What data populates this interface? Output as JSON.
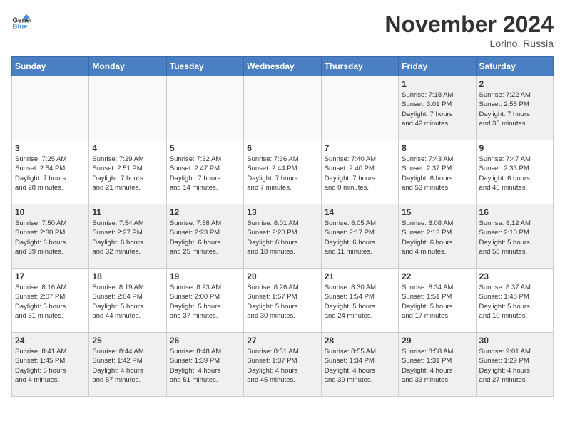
{
  "header": {
    "logo_general": "General",
    "logo_blue": "Blue",
    "month": "November 2024",
    "location": "Lorino, Russia"
  },
  "weekdays": [
    "Sunday",
    "Monday",
    "Tuesday",
    "Wednesday",
    "Thursday",
    "Friday",
    "Saturday"
  ],
  "weeks": [
    [
      {
        "day": "",
        "info": "",
        "empty": true
      },
      {
        "day": "",
        "info": "",
        "empty": true
      },
      {
        "day": "",
        "info": "",
        "empty": true
      },
      {
        "day": "",
        "info": "",
        "empty": true
      },
      {
        "day": "",
        "info": "",
        "empty": true
      },
      {
        "day": "1",
        "info": "Sunrise: 7:18 AM\nSunset: 3:01 PM\nDaylight: 7 hours\nand 42 minutes."
      },
      {
        "day": "2",
        "info": "Sunrise: 7:22 AM\nSunset: 2:58 PM\nDaylight: 7 hours\nand 35 minutes."
      }
    ],
    [
      {
        "day": "3",
        "info": "Sunrise: 7:25 AM\nSunset: 2:54 PM\nDaylight: 7 hours\nand 28 minutes."
      },
      {
        "day": "4",
        "info": "Sunrise: 7:29 AM\nSunset: 2:51 PM\nDaylight: 7 hours\nand 21 minutes."
      },
      {
        "day": "5",
        "info": "Sunrise: 7:32 AM\nSunset: 2:47 PM\nDaylight: 7 hours\nand 14 minutes."
      },
      {
        "day": "6",
        "info": "Sunrise: 7:36 AM\nSunset: 2:44 PM\nDaylight: 7 hours\nand 7 minutes."
      },
      {
        "day": "7",
        "info": "Sunrise: 7:40 AM\nSunset: 2:40 PM\nDaylight: 7 hours\nand 0 minutes."
      },
      {
        "day": "8",
        "info": "Sunrise: 7:43 AM\nSunset: 2:37 PM\nDaylight: 6 hours\nand 53 minutes."
      },
      {
        "day": "9",
        "info": "Sunrise: 7:47 AM\nSunset: 2:33 PM\nDaylight: 6 hours\nand 46 minutes."
      }
    ],
    [
      {
        "day": "10",
        "info": "Sunrise: 7:50 AM\nSunset: 2:30 PM\nDaylight: 6 hours\nand 39 minutes."
      },
      {
        "day": "11",
        "info": "Sunrise: 7:54 AM\nSunset: 2:27 PM\nDaylight: 6 hours\nand 32 minutes."
      },
      {
        "day": "12",
        "info": "Sunrise: 7:58 AM\nSunset: 2:23 PM\nDaylight: 6 hours\nand 25 minutes."
      },
      {
        "day": "13",
        "info": "Sunrise: 8:01 AM\nSunset: 2:20 PM\nDaylight: 6 hours\nand 18 minutes."
      },
      {
        "day": "14",
        "info": "Sunrise: 8:05 AM\nSunset: 2:17 PM\nDaylight: 6 hours\nand 11 minutes."
      },
      {
        "day": "15",
        "info": "Sunrise: 8:08 AM\nSunset: 2:13 PM\nDaylight: 6 hours\nand 4 minutes."
      },
      {
        "day": "16",
        "info": "Sunrise: 8:12 AM\nSunset: 2:10 PM\nDaylight: 5 hours\nand 58 minutes."
      }
    ],
    [
      {
        "day": "17",
        "info": "Sunrise: 8:16 AM\nSunset: 2:07 PM\nDaylight: 5 hours\nand 51 minutes."
      },
      {
        "day": "18",
        "info": "Sunrise: 8:19 AM\nSunset: 2:04 PM\nDaylight: 5 hours\nand 44 minutes."
      },
      {
        "day": "19",
        "info": "Sunrise: 8:23 AM\nSunset: 2:00 PM\nDaylight: 5 hours\nand 37 minutes."
      },
      {
        "day": "20",
        "info": "Sunrise: 8:26 AM\nSunset: 1:57 PM\nDaylight: 5 hours\nand 30 minutes."
      },
      {
        "day": "21",
        "info": "Sunrise: 8:30 AM\nSunset: 1:54 PM\nDaylight: 5 hours\nand 24 minutes."
      },
      {
        "day": "22",
        "info": "Sunrise: 8:34 AM\nSunset: 1:51 PM\nDaylight: 5 hours\nand 17 minutes."
      },
      {
        "day": "23",
        "info": "Sunrise: 8:37 AM\nSunset: 1:48 PM\nDaylight: 5 hours\nand 10 minutes."
      }
    ],
    [
      {
        "day": "24",
        "info": "Sunrise: 8:41 AM\nSunset: 1:45 PM\nDaylight: 5 hours\nand 4 minutes."
      },
      {
        "day": "25",
        "info": "Sunrise: 8:44 AM\nSunset: 1:42 PM\nDaylight: 4 hours\nand 57 minutes."
      },
      {
        "day": "26",
        "info": "Sunrise: 8:48 AM\nSunset: 1:39 PM\nDaylight: 4 hours\nand 51 minutes."
      },
      {
        "day": "27",
        "info": "Sunrise: 8:51 AM\nSunset: 1:37 PM\nDaylight: 4 hours\nand 45 minutes."
      },
      {
        "day": "28",
        "info": "Sunrise: 8:55 AM\nSunset: 1:34 PM\nDaylight: 4 hours\nand 39 minutes."
      },
      {
        "day": "29",
        "info": "Sunrise: 8:58 AM\nSunset: 1:31 PM\nDaylight: 4 hours\nand 33 minutes."
      },
      {
        "day": "30",
        "info": "Sunrise: 9:01 AM\nSunset: 1:29 PM\nDaylight: 4 hours\nand 27 minutes."
      }
    ]
  ]
}
